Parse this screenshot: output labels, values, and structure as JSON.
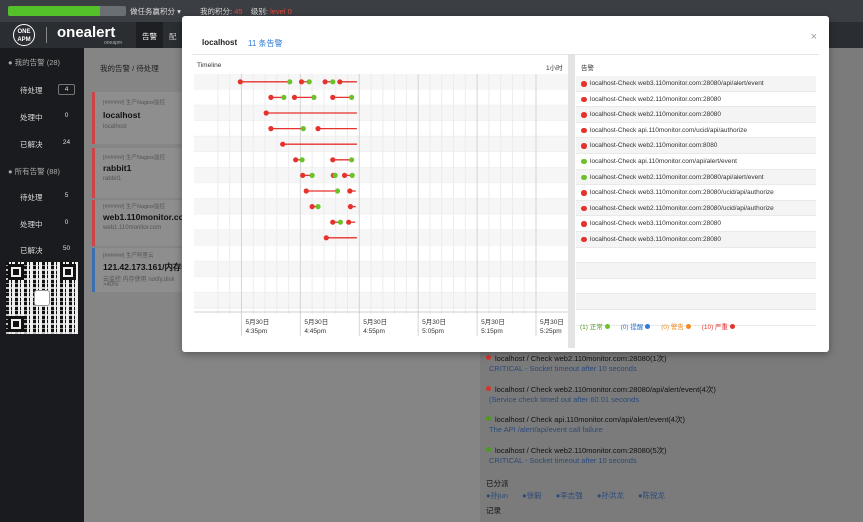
{
  "topbar": {
    "tasks_label": "做任务赢积分",
    "tasks_caret": "▾",
    "points_label": "我的积分:",
    "points_value": "45",
    "level_label": "级别:",
    "level_value": "level 0",
    "progress_fraction": 0.78
  },
  "brand": {
    "badge_text": "ONE APM",
    "name": "onealert",
    "sub": "oneapm"
  },
  "nav": {
    "tabs": [
      {
        "label": "告警",
        "active": true
      },
      {
        "label": "配"
      }
    ]
  },
  "sidebar": {
    "my_alerts_head": "我的告警 (28)",
    "my_items": [
      {
        "label": "待处理",
        "count": "4"
      },
      {
        "label": "处理中",
        "count": "0"
      },
      {
        "label": "已解决",
        "count": "24"
      }
    ],
    "all_alerts_head": "所有告警 (88)",
    "all_items": [
      {
        "label": "待处理",
        "count": "5"
      },
      {
        "label": "处理中",
        "count": "0"
      },
      {
        "label": "已解决",
        "count": "50"
      }
    ]
  },
  "middle": {
    "breadcrumb": "我的告警  /  待处理",
    "cards": [
      {
        "src": "[######] 生产Nagios监控",
        "title": "localhost",
        "sub": "localhost"
      },
      {
        "src": "[######] 生产Nagios监控",
        "title": "rabbit1",
        "sub": "rabbit1"
      },
      {
        "src": "[######] 生产Nagios监控",
        "title": "web1.110monitor.com",
        "sub": "web1.110monitor.com"
      },
      {
        "src": "[######] 生产阿里云",
        "title": "121.42.173.161/内存使",
        "sub": "云监控 内存使用 notify.disk",
        "sub2": ">40%"
      }
    ]
  },
  "detail": {
    "lines": [
      {
        "text": "localhost / Check web2.110monitor.com:28080(1次)",
        "sub": "CRITICAL - Socket timeout after 10 seconds",
        "dot": "#d9342b"
      },
      {
        "text": "localhost / Check web2.110monitor.com:28080/api/alert/event(4次)",
        "sub": "(Service check timed out after 60.01 seconds",
        "dot": "#d9342b"
      },
      {
        "text": "localhost / Check api.110monitor.com/api/alert/event(4次)",
        "sub": "The API /alert/api/event call failure",
        "dot": "#4e9a1c"
      },
      {
        "text": "localhost / Check web2.110monitor.com:28080(5次)",
        "sub": "CRITICAL - Socket timeout after 10 seconds",
        "dot": "#4e9a1c"
      }
    ],
    "assigned_label": "已分派",
    "assignees": [
      "孙jun",
      "徐毅",
      "李志强",
      "孙洪龙",
      "陈锐龙"
    ],
    "record_label": "记录"
  },
  "modal": {
    "title": "localhost",
    "count": "11 条告警",
    "close_icon": "close-icon",
    "timeline_label": "Timeline",
    "scale_label": "1小时",
    "alerts_label": "告警",
    "alerts": [
      {
        "text": "localhost-Check web3.110monitor.com:28080/api/alert/event",
        "color": "#e5322d"
      },
      {
        "text": "localhost-Check web2.110monitor.com:28080",
        "color": "#e5322d"
      },
      {
        "text": "localhost-Check web2.110monitor.com:28080",
        "color": "#e5322d"
      },
      {
        "text": "localhost-Check api.110monitor.com/ucid/api/authorize",
        "color": "#e5322d"
      },
      {
        "text": "localhost-Check web2.110monitor.com:8080",
        "color": "#e5322d"
      },
      {
        "text": "localhost-Check api.110monitor.com/api/alert/event",
        "color": "#6cc12a"
      },
      {
        "text": "localhost-Check web2.110monitor.com:28080/api/alert/event",
        "color": "#6cc12a"
      },
      {
        "text": "localhost-Check web3.110monitor.com:28080/ucid/api/authorize",
        "color": "#e5322d"
      },
      {
        "text": "localhost-Check web2.110monitor.com:28080/ucid/api/authorize",
        "color": "#e5322d"
      },
      {
        "text": "localhost-Check web3.110monitor.com:28080",
        "color": "#e5322d"
      },
      {
        "text": "localhost-Check web3.110monitor.com:28080",
        "color": "#e5322d"
      }
    ],
    "legend": [
      {
        "label": "(1) 正常",
        "color": "#6cc12a",
        "text_color": "#4e9a1c"
      },
      {
        "label": "(0) 提醒",
        "color": "#2e7ad6",
        "text_color": "#2e7ad6"
      },
      {
        "label": "(0) 警告",
        "color": "#f08a24",
        "text_color": "#f08a24"
      },
      {
        "label": "(10) 严重",
        "color": "#e5322d",
        "text_color": "#e5322d"
      }
    ]
  },
  "chart_data": {
    "type": "timeline",
    "x_unit": "minutes after 5月30日 4:35pm",
    "x_range": [
      -5,
      50
    ],
    "x_ticks": [
      {
        "at": 0,
        "label": [
          "5月30日",
          "4:35pm"
        ]
      },
      {
        "at": 10,
        "label": [
          "5月30日",
          "4:45pm"
        ]
      },
      {
        "at": 20,
        "label": [
          "5月30日",
          "4:55pm"
        ]
      },
      {
        "at": 30,
        "label": [
          "5月30日",
          "5:05pm"
        ]
      },
      {
        "at": 40,
        "label": [
          "5月30日",
          "5:15pm"
        ]
      },
      {
        "at": 50,
        "label": [
          "5月30日",
          "5:25pm"
        ]
      }
    ],
    "rows": [
      {
        "segments": [
          [
            -0.2,
            8.2
          ],
          [
            10.2,
            11.5
          ],
          [
            14.2,
            15.5
          ],
          [
            16.7,
            19.6
          ]
        ],
        "points": [
          [
            -0.2,
            "r"
          ],
          [
            8.2,
            "g"
          ],
          [
            10.2,
            "r"
          ],
          [
            11.5,
            "g"
          ],
          [
            14.2,
            "r"
          ],
          [
            15.5,
            "g"
          ],
          [
            16.7,
            "r"
          ]
        ]
      },
      {
        "segments": [
          [
            5.0,
            7.2
          ],
          [
            9.0,
            12.3
          ],
          [
            15.5,
            18.7
          ]
        ],
        "points": [
          [
            5.0,
            "r"
          ],
          [
            7.2,
            "g"
          ],
          [
            9.0,
            "r"
          ],
          [
            12.3,
            "g"
          ],
          [
            15.5,
            "r"
          ],
          [
            18.7,
            "g"
          ]
        ]
      },
      {
        "segments": [
          [
            4.2,
            19.6
          ]
        ],
        "points": [
          [
            4.2,
            "r"
          ]
        ]
      },
      {
        "segments": [
          [
            5.0,
            10.5
          ],
          [
            13.0,
            19.6
          ]
        ],
        "points": [
          [
            5.0,
            "r"
          ],
          [
            10.5,
            "g"
          ],
          [
            13.0,
            "r"
          ]
        ]
      },
      {
        "segments": [
          [
            7.0,
            19.6
          ]
        ],
        "points": [
          [
            7.0,
            "r"
          ]
        ]
      },
      {
        "segments": [
          [
            9.2,
            10.3
          ],
          [
            15.5,
            18.7
          ]
        ],
        "points": [
          [
            9.2,
            "r"
          ],
          [
            10.3,
            "g"
          ],
          [
            15.5,
            "r"
          ],
          [
            18.7,
            "g"
          ]
        ]
      },
      {
        "segments": [
          [
            10.4,
            12.0
          ],
          [
            15.6,
            15.9
          ],
          [
            17.5,
            18.8
          ]
        ],
        "points": [
          [
            10.4,
            "r"
          ],
          [
            12.0,
            "g"
          ],
          [
            15.6,
            "r"
          ],
          [
            15.9,
            "g"
          ],
          [
            17.5,
            "r"
          ],
          [
            18.8,
            "g"
          ]
        ]
      },
      {
        "segments": [
          [
            11.0,
            16.3
          ],
          [
            18.4,
            19.4
          ]
        ],
        "points": [
          [
            11.0,
            "r"
          ],
          [
            16.3,
            "g"
          ],
          [
            18.4,
            "r"
          ]
        ]
      },
      {
        "segments": [
          [
            12.0,
            13.0
          ],
          [
            18.5,
            19.4
          ]
        ],
        "points": [
          [
            12.0,
            "r"
          ],
          [
            13.0,
            "g"
          ],
          [
            18.5,
            "r"
          ]
        ]
      },
      {
        "segments": [
          [
            15.5,
            16.8
          ],
          [
            18.2,
            19.3
          ]
        ],
        "points": [
          [
            15.5,
            "r"
          ],
          [
            16.8,
            "g"
          ],
          [
            18.2,
            "r"
          ]
        ]
      },
      {
        "segments": [
          [
            14.4,
            19.6
          ]
        ],
        "points": [
          [
            14.4,
            "r"
          ]
        ]
      }
    ],
    "colors": {
      "r": "#e5322d",
      "g": "#6cc12a",
      "line": "#e5322d"
    }
  }
}
